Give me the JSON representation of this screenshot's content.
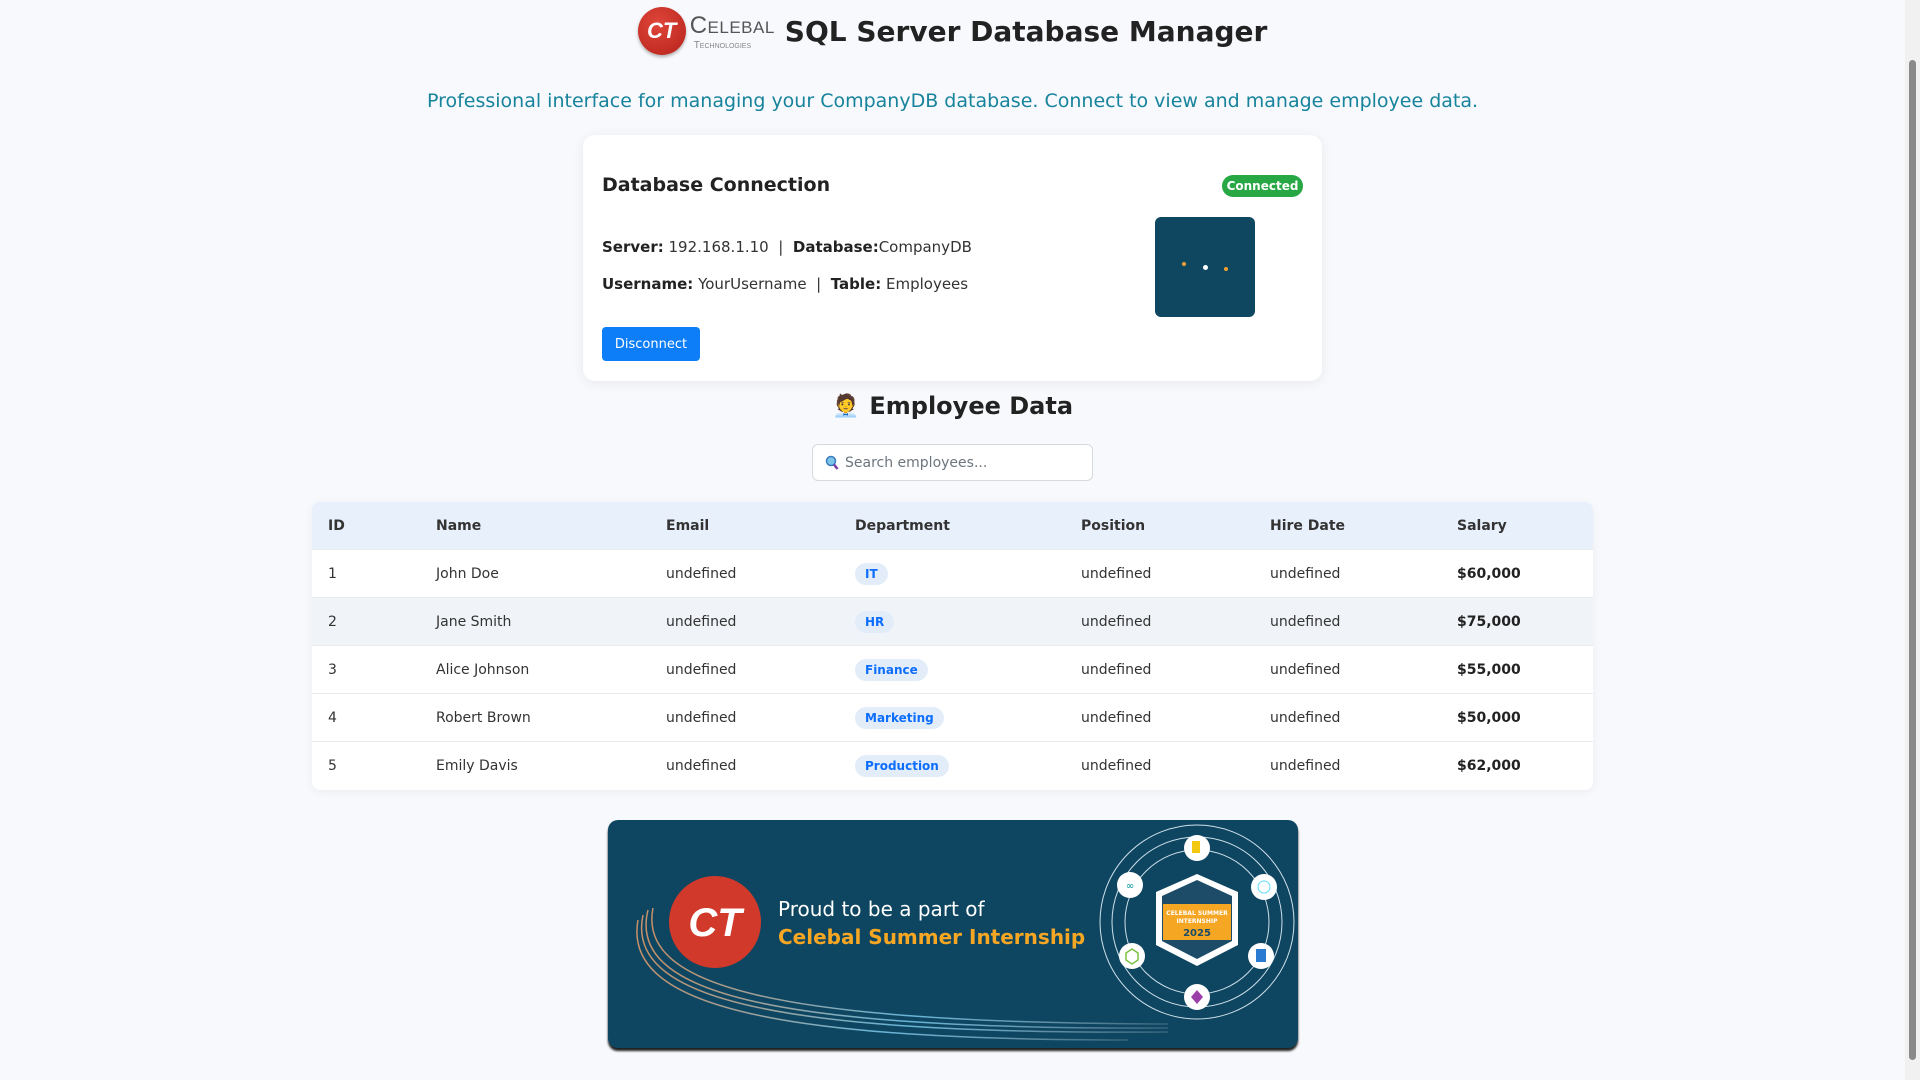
{
  "header": {
    "logo_text": "Celebal",
    "logo_sub": "Technologies",
    "logo_mark": "CT",
    "title": "SQL Server Database Manager"
  },
  "subtitle": "Professional interface for managing your CompanyDB database. Connect to view and manage employee data.",
  "connection": {
    "title": "Database Connection",
    "status": "Connected",
    "server_label": "Server:",
    "server": "192.168.1.10",
    "database_label": "Database:",
    "database": "CompanyDB",
    "username_label": "Username:",
    "username": "YourUsername",
    "table_label": "Table:",
    "table": "Employees",
    "separator": "|",
    "disconnect_label": "Disconnect"
  },
  "employees": {
    "icon": "🧑‍💼",
    "title": "Employee Data",
    "search_placeholder": "Search employees...",
    "columns": [
      "ID",
      "Name",
      "Email",
      "Department",
      "Position",
      "Hire Date",
      "Salary"
    ],
    "rows": [
      {
        "id": "1",
        "name": "John Doe",
        "email": "undefined",
        "department": "IT",
        "position": "undefined",
        "hire_date": "undefined",
        "salary": "$60,000"
      },
      {
        "id": "2",
        "name": "Jane Smith",
        "email": "undefined",
        "department": "HR",
        "position": "undefined",
        "hire_date": "undefined",
        "salary": "$75,000"
      },
      {
        "id": "3",
        "name": "Alice Johnson",
        "email": "undefined",
        "department": "Finance",
        "position": "undefined",
        "hire_date": "undefined",
        "salary": "$55,000"
      },
      {
        "id": "4",
        "name": "Robert Brown",
        "email": "undefined",
        "department": "Marketing",
        "position": "undefined",
        "hire_date": "undefined",
        "salary": "$50,000"
      },
      {
        "id": "5",
        "name": "Emily Davis",
        "email": "undefined",
        "department": "Production",
        "position": "undefined",
        "hire_date": "undefined",
        "salary": "$62,000"
      }
    ]
  },
  "banner": {
    "line1": "Proud to be a part of",
    "line2": "Celebal Summer Internship",
    "badge_line1": "CELEBAL SUMMER",
    "badge_line2": "INTERNSHIP",
    "badge_year": "2025",
    "logo_mark": "CT"
  },
  "colors": {
    "accent": "#0d7ef7",
    "success": "#28a745",
    "subtitle": "#17839c",
    "banner_bg": "#0e4661",
    "banner_orange": "#f5a623"
  }
}
